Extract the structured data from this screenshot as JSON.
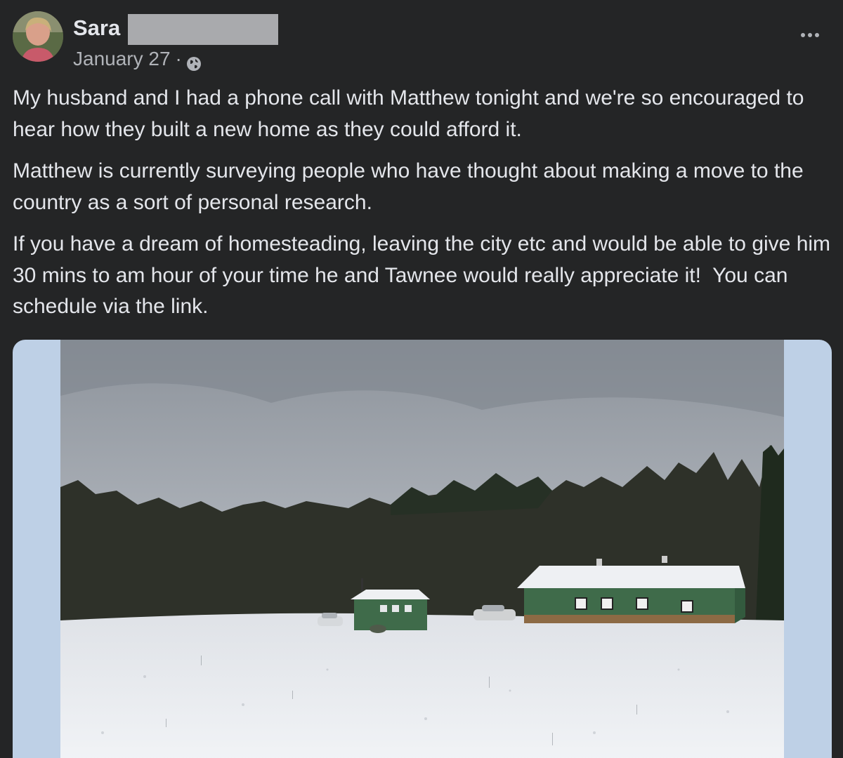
{
  "post": {
    "author": {
      "first_name": "Sara"
    },
    "date": "January 27",
    "separator": "·",
    "privacy_icon": "globe-icon",
    "more_icon": "more-options-icon",
    "paragraphs": [
      "My husband and I had a phone call with Matthew tonight and we're so encouraged to hear how they built a new home as they could afford it.",
      "Matthew is currently surveying people who have thought about making a move to the country as a sort of personal research.",
      "If you have a dream of homesteading, leaving the city etc and would be able to give him 30 mins to am hour of your time he and Tawnee would really appreciate it!  You can schedule via the link."
    ],
    "photo": {
      "frame_color": "#bed0e6"
    }
  },
  "colors": {
    "background": "#242526",
    "primary_text": "#e4e6eb",
    "secondary_text": "#b0b3b8",
    "redaction": "#a9aaad",
    "building_green": "#3f6b4a",
    "snow": "#eef0f3"
  }
}
